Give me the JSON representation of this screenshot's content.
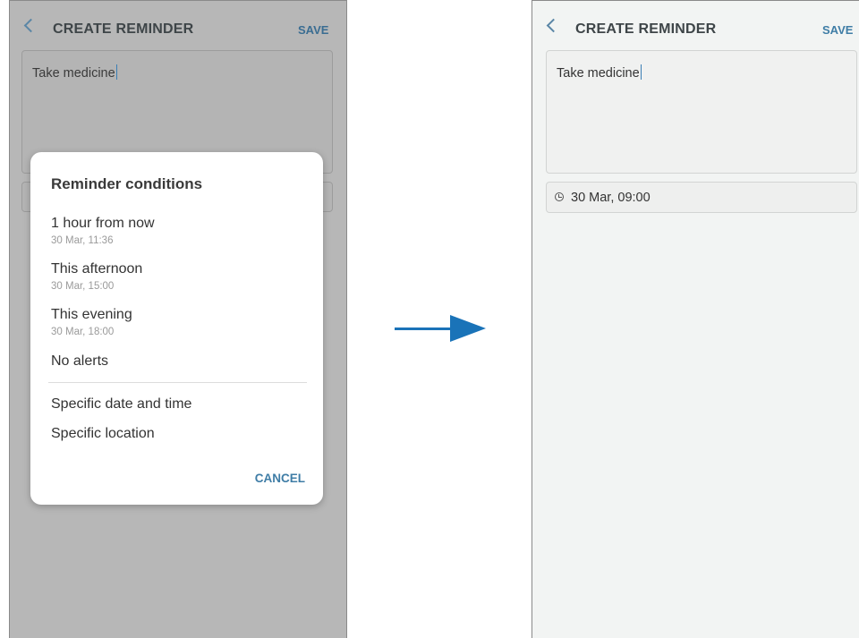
{
  "left_screen": {
    "header": {
      "title": "CREATE REMINDER",
      "save_label": "SAVE"
    },
    "note": {
      "text": "Take medicine"
    },
    "dialog": {
      "title": "Reminder conditions",
      "options": [
        {
          "label": "1 hour from now",
          "sub": "30 Mar, 11:36"
        },
        {
          "label": "This afternoon",
          "sub": "30 Mar, 15:00"
        },
        {
          "label": "This evening",
          "sub": "30 Mar, 18:00"
        },
        {
          "label": "No alerts"
        },
        {
          "label": "Specific date and time"
        },
        {
          "label": "Specific location"
        }
      ],
      "cancel_label": "CANCEL"
    }
  },
  "right_screen": {
    "header": {
      "title": "CREATE REMINDER",
      "save_label": "SAVE"
    },
    "note": {
      "text": "Take medicine"
    },
    "condition": {
      "icon": "clock-icon",
      "text": "30 Mar, 09:00"
    }
  },
  "colors": {
    "accent": "#3f7da6",
    "arrow": "#1a73b8",
    "dim_overlay": "#b7b7b7"
  }
}
